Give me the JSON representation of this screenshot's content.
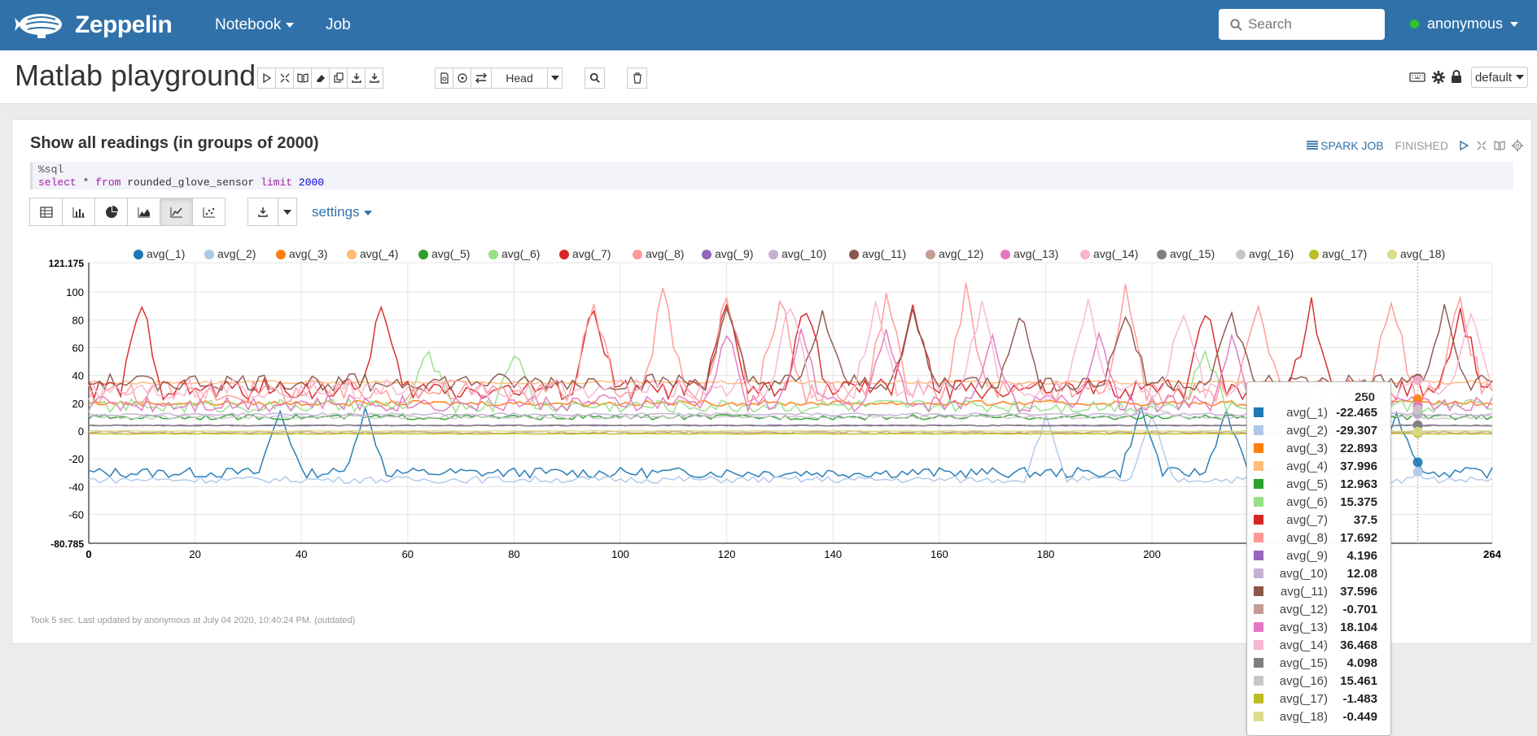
{
  "navbar": {
    "brand": "Zeppelin",
    "notebook_label": "Notebook",
    "job_label": "Job",
    "search_placeholder": "Search",
    "user_name": "anonymous"
  },
  "toolbar": {
    "title": "Matlab playground",
    "head_label": "Head",
    "default_label": "default"
  },
  "paragraph": {
    "title": "Show all readings (in groups of 2000)",
    "spark_job_label": "SPARK JOB",
    "status": "FINISHED",
    "code_line1": "%sql",
    "code_select": "select",
    "code_star": " * ",
    "code_from": "from",
    "code_table": " rounded_glove_sensor ",
    "code_limit": "limit",
    "code_num": " 2000",
    "settings_label": "settings",
    "footer": "Took 5 sec. Last updated by anonymous at July 04 2020, 10:40:24 PM. (outdated)"
  },
  "chart_data": {
    "type": "line",
    "x_range": [
      0,
      264
    ],
    "y_range": [
      -80.785,
      121.175
    ],
    "y_ticks": [
      -80.785,
      -60,
      -40,
      -20,
      0,
      20,
      40,
      60,
      80,
      100,
      121.175
    ],
    "x_ticks": [
      0,
      20,
      40,
      60,
      80,
      100,
      120,
      140,
      160,
      180,
      200,
      264
    ],
    "grid": true,
    "legend_position": "top",
    "hover_x": 250,
    "series": [
      {
        "name": "avg(_1)",
        "color": "#1f77b4",
        "value_at_hover": -22.465
      },
      {
        "name": "avg(_2)",
        "color": "#aec7e8",
        "value_at_hover": -29.307
      },
      {
        "name": "avg(_3)",
        "color": "#ff7f0e",
        "value_at_hover": 22.893
      },
      {
        "name": "avg(_4)",
        "color": "#ffbb78",
        "value_at_hover": 37.996
      },
      {
        "name": "avg(_5)",
        "color": "#2ca02c",
        "value_at_hover": 12.963
      },
      {
        "name": "avg(_6)",
        "color": "#98df8a",
        "value_at_hover": 15.375
      },
      {
        "name": "avg(_7)",
        "color": "#d62728",
        "value_at_hover": 37.5
      },
      {
        "name": "avg(_8)",
        "color": "#ff9896",
        "value_at_hover": 17.692
      },
      {
        "name": "avg(_9)",
        "color": "#9467bd",
        "value_at_hover": 4.196
      },
      {
        "name": "avg(_10)",
        "color": "#c5b0d5",
        "value_at_hover": 12.08
      },
      {
        "name": "avg(_11)",
        "color": "#8c564b",
        "value_at_hover": 37.596
      },
      {
        "name": "avg(_12)",
        "color": "#c49c94",
        "value_at_hover": -0.701
      },
      {
        "name": "avg(_13)",
        "color": "#e377c2",
        "value_at_hover": 18.104
      },
      {
        "name": "avg(_14)",
        "color": "#f7b6d2",
        "value_at_hover": 36.468
      },
      {
        "name": "avg(_15)",
        "color": "#7f7f7f",
        "value_at_hover": 4.098
      },
      {
        "name": "avg(_16)",
        "color": "#c7c7c7",
        "value_at_hover": 15.461
      },
      {
        "name": "avg(_17)",
        "color": "#bcbd22",
        "value_at_hover": -1.483
      },
      {
        "name": "avg(_18)",
        "color": "#dbdb8d",
        "value_at_hover": -0.449
      }
    ]
  }
}
